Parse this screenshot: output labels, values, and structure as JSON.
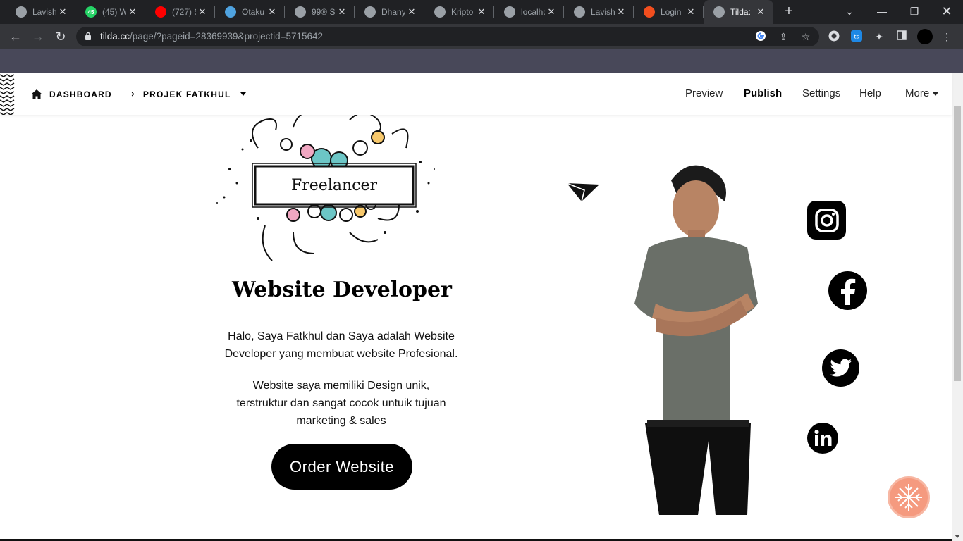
{
  "browser": {
    "tabs": [
      {
        "title": "Lavish",
        "icon": "globe-icon",
        "color": "#9aa0a6"
      },
      {
        "title": "(45) W",
        "icon": "whatsapp-icon",
        "color": "#25d366",
        "badge": "45"
      },
      {
        "title": "(727) S",
        "icon": "youtube-icon",
        "color": "#ff0000"
      },
      {
        "title": "Otaku",
        "icon": "otaku-icon",
        "color": "#4fa3e0"
      },
      {
        "title": "99® S",
        "icon": "globe-icon",
        "color": "#9aa0a6"
      },
      {
        "title": "Dhany",
        "icon": "globe-icon",
        "color": "#9aa0a6"
      },
      {
        "title": "Kripto",
        "icon": "globe-icon",
        "color": "#9aa0a6"
      },
      {
        "title": "localho",
        "icon": "globe-icon",
        "color": "#9aa0a6"
      },
      {
        "title": "Lavish",
        "icon": "globe-icon",
        "color": "#9aa0a6"
      },
      {
        "title": "Login",
        "icon": "figma-icon",
        "color": "#f24e1e"
      },
      {
        "title": "Tilda: I",
        "icon": "tilda-icon",
        "color": "#9aa0a6",
        "active": true
      }
    ],
    "url_host": "tilda.cc",
    "url_path": "/page/?pageid=28369939&projectid=5715642"
  },
  "tilda_header": {
    "crumb_dashboard": "DASHBOARD",
    "crumb_arrow": "⟶",
    "crumb_project": "PROJEK FATKHUL",
    "nav": {
      "preview": "Preview",
      "publish": "Publish",
      "settings": "Settings",
      "help": "Help",
      "more": "More"
    }
  },
  "content": {
    "badge_text": "Freelancer",
    "headline": "Website Developer",
    "para1": "Halo, Saya Fatkhul dan Saya adalah Website Developer yang membuat website Profesional.",
    "para2": "Website saya memiliki Design unik, terstruktur dan sangat cocok untuik tujuan marketing & sales",
    "cta": "Order Website",
    "socials": [
      "instagram-icon",
      "facebook-icon",
      "twitter-icon",
      "linkedin-icon"
    ]
  },
  "colors": {
    "fab": "#f59a7f",
    "cta_bg": "#000000",
    "chrome_dark": "#202124",
    "chrome_mid": "#35363a",
    "strip": "#484859"
  }
}
